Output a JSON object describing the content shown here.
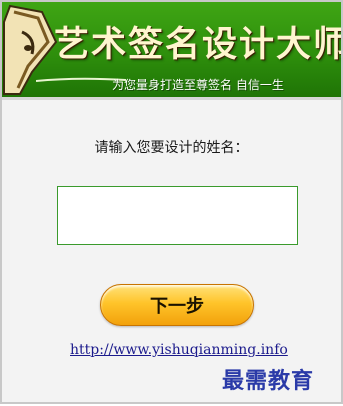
{
  "banner": {
    "title": "艺术签名设计大师",
    "subtitle": "为您量身打造至尊签名 自信一生",
    "logo_icon": "pen-nib-icon",
    "colors": {
      "green": "#2e8f0c",
      "title": "#fff5cf"
    }
  },
  "form": {
    "prompt": "请输入您要设计的姓名：",
    "name_value": "",
    "next_label": "下一步"
  },
  "footer": {
    "link_text": "http://www.yishuqianming.info",
    "link_color": "#1b1a8c"
  },
  "watermark": "最需教育",
  "colors": {
    "button": "#ffc42a",
    "input_border": "#3a9a2c"
  }
}
